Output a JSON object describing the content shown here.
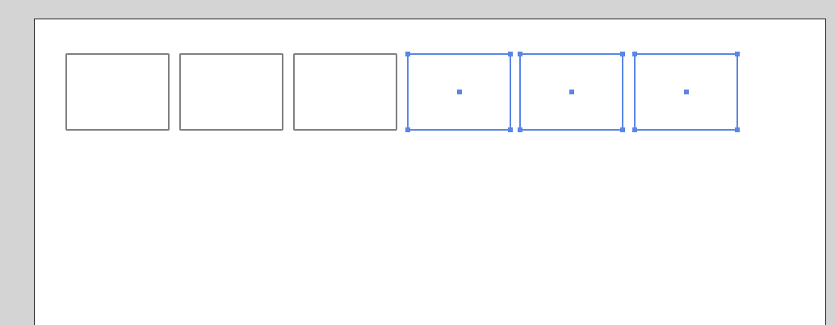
{
  "canvas": {
    "shapes": [
      {
        "name": "rectangle-1",
        "selected": false
      },
      {
        "name": "rectangle-2",
        "selected": false
      },
      {
        "name": "rectangle-3",
        "selected": false
      },
      {
        "name": "rectangle-4",
        "selected": true
      },
      {
        "name": "rectangle-5",
        "selected": true
      },
      {
        "name": "rectangle-6",
        "selected": true
      }
    ],
    "colors": {
      "pasteboard": "#d4d4d4",
      "artboard": "#ffffff",
      "artboard_border": "#222222",
      "shape_stroke": "#808080",
      "selection": "#5b86e5"
    }
  }
}
